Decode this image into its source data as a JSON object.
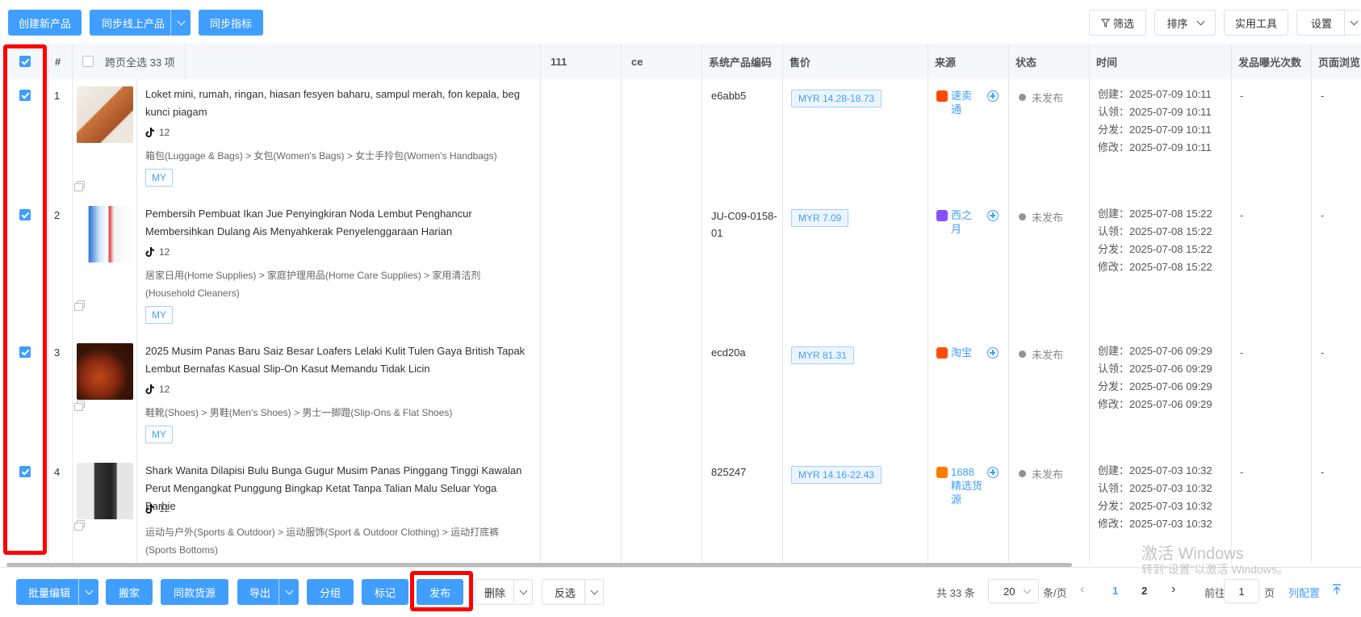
{
  "toolbar": {
    "create": "创建新产品",
    "sync_online": "同步线上产品",
    "sync_metrics": "同步指标",
    "filter": "筛选",
    "sort": "排序",
    "tools": "实用工具",
    "settings": "设置"
  },
  "table": {
    "headers": {
      "index": "#",
      "select_all": "跨页全选 33 项",
      "col_111": "111",
      "col_ce": "ce",
      "sku": "系统产品编码",
      "price": "售价",
      "source": "来源",
      "status": "状态",
      "time": "时间",
      "exposure": "发品曝光次数",
      "views": "页面浏览"
    },
    "rows": [
      {
        "index": "1",
        "title": "Loket mini, rumah, ringan, hiasan fesyen baharu, sampul merah, fon kepala, beg kunci piagam",
        "tiktok_count": "12",
        "category": "箱包(Luggage & Bags) > 女包(Women's Bags) > 女士手拎包(Women's Handbags)",
        "region": "MY",
        "sku": "e6abb5",
        "price": "MYR  14.28-18.73",
        "source": "速卖通",
        "source_color": "#ff4a00",
        "status": "未发布",
        "created": "创建：2025-07-09 10:11",
        "claimed": "认领：2025-07-09 10:11",
        "distributed": "分发：2025-07-09 10:11",
        "modified": "修改：2025-07-09 10:11",
        "exposure": "-",
        "views": "-"
      },
      {
        "index": "2",
        "title": "Pembersih Pembuat Ikan Jue Penyingkiran Noda Lembut Penghancur Membersihkan Dulang Ais Menyahkerak Penyelenggaraan Harian",
        "tiktok_count": "12",
        "category": "居家日用(Home Supplies) > 家庭护理用品(Home Care Supplies) > 家用清洁剂(Household Cleaners)",
        "region": "MY",
        "sku": "JU-C09-0158-01",
        "price": "MYR  7.09",
        "source": "西之月",
        "source_color": "#8a4dff",
        "status": "未发布",
        "created": "创建：2025-07-08 15:22",
        "claimed": "认领：2025-07-08 15:22",
        "distributed": "分发：2025-07-08 15:22",
        "modified": "修改：2025-07-08 15:22",
        "exposure": "-",
        "views": "-"
      },
      {
        "index": "3",
        "title": "2025 Musim Panas Baru Saiz Besar Loafers Lelaki Kulit Tulen Gaya British Tapak Lembut Bernafas Kasual Slip-On Kasut Memandu Tidak Licin",
        "tiktok_count": "12",
        "category": "鞋靴(Shoes) > 男鞋(Men's Shoes) > 男士一脚蹬(Slip-Ons & Flat Shoes)",
        "region": "MY",
        "sku": "ecd20a",
        "price": "MYR  81.31",
        "source": "淘宝",
        "source_color": "#ff5000",
        "status": "未发布",
        "created": "创建：2025-07-06 09:29",
        "claimed": "认领：2025-07-06 09:29",
        "distributed": "分发：2025-07-06 09:29",
        "modified": "修改：2025-07-06 09:29",
        "exposure": "-",
        "views": "-"
      },
      {
        "index": "4",
        "title": "Shark Wanita Dilapisi Bulu Bunga Gugur Musim Panas Pinggang Tinggi Kawalan Perut Mengangkat Punggung Bingkap Ketat Tanpa Talian Malu Seluar Yoga Barbie",
        "tiktok_count": "12",
        "category": "运动与户外(Sports & Outdoor) > 运动服饰(Sport & Outdoor Clothing) > 运动打底裤(Sports Bottoms)",
        "region": "",
        "sku": "825247",
        "price": "MYR  14.16-22.43",
        "source": "1688精选货源",
        "source_color": "#ff7a00",
        "status": "未发布",
        "created": "创建：2025-07-03 10:32",
        "claimed": "认领：2025-07-03 10:32",
        "distributed": "分发：2025-07-03 10:32",
        "modified": "修改：2025-07-03 10:32",
        "exposure": "-",
        "views": "-"
      }
    ]
  },
  "footer": {
    "batch_edit": "批量编辑",
    "move": "搬家",
    "same_source": "同款货源",
    "export": "导出",
    "group": "分组",
    "mark": "标记",
    "publish": "发布",
    "delete": "删除",
    "invert": "反选",
    "total": "共 33 条",
    "page_size": "20",
    "per_page": "条/页",
    "page1": "1",
    "page2": "2",
    "goto": "前往",
    "goto_value": "1",
    "page_unit": "页",
    "col_config": "列配置"
  },
  "watermark": {
    "line1": "激活 Windows",
    "line2": "转到“设置”以激活 Windows。"
  },
  "colors": {
    "primary": "#409eff",
    "highlight": "#ff0000"
  }
}
